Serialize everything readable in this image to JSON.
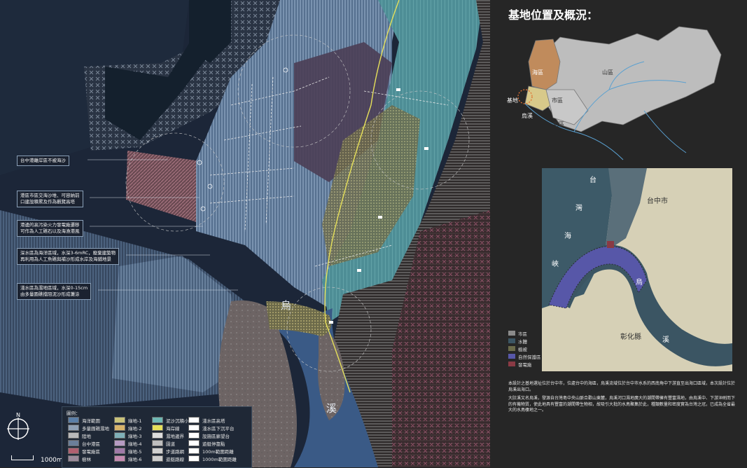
{
  "title": "基地位置及概況：",
  "callouts": [
    "台中港離岸區不被海沙",
    "港區市區交海沙堆、可容納前\n口建設積累及作為觀覽高塔",
    "港邊的高污染火力發電廠遷移\n可作為人工礁石以及海漁港風",
    "深水區為海洋區域，水深3-6mRC，廢棄建築物\n再利用為人工魚礁與補沙形成水岸及海鋪地景",
    "淺水區為濕地區域，水深0-15cm\n由多量圓礁擋阻泥沙形成灘涂"
  ],
  "map_labels": {
    "wu": "烏",
    "xi": "溪"
  },
  "scale_label": "1000m",
  "compass_label": "N",
  "legend": {
    "title": "圖例：",
    "items": [
      {
        "label": "海洋範圍",
        "color": "#5b7fa8"
      },
      {
        "label": "多量圓礁濕地",
        "color": "#8fa0b5"
      },
      {
        "label": "陸地",
        "color": "#b9b9b9"
      },
      {
        "label": "台中港區",
        "color": "#6b7f99"
      },
      {
        "label": "發電廠區",
        "color": "#b06070"
      },
      {
        "label": "樹林",
        "color": "#9a8a9a"
      },
      {
        "label": "綠地-1",
        "color": "#c9c27a"
      },
      {
        "label": "綠地-2",
        "color": "#d7b36a"
      },
      {
        "label": "綠地-3",
        "color": "#7fb0b8"
      },
      {
        "label": "綠地-4",
        "color": "#b59bc2"
      },
      {
        "label": "綠地-5",
        "color": "#a07aa8"
      },
      {
        "label": "綠地-6",
        "color": "#c38ab0"
      },
      {
        "label": "泥沙沉積小島",
        "color": "#6fb8b4"
      },
      {
        "label": "海岸線",
        "color": "#e6e05a"
      },
      {
        "label": "濕地邊界",
        "color": "#dddddd"
      },
      {
        "label": "園道",
        "color": "#bfbfbf"
      },
      {
        "label": "步道路網",
        "color": "#d0d0d0"
      },
      {
        "label": "遊艇路線",
        "color": "#cccccc"
      },
      {
        "label": "淺水區高塔",
        "color": "#ffffff"
      },
      {
        "label": "淺水區下沉平台",
        "color": "#ffffff"
      },
      {
        "label": "設施區廊望台",
        "color": "#ffffff"
      },
      {
        "label": "遊艇停靠點",
        "color": "#ffffff"
      },
      {
        "label": "100m範圍距離",
        "color": "#ffffff"
      },
      {
        "label": "1000m範圍距離",
        "color": "#ffffff"
      }
    ]
  },
  "inset_top": {
    "labels": {
      "hai": "海區",
      "shan": "山區",
      "shi": "市區",
      "tun": "屯區",
      "jidi": "基地",
      "wuxi": "烏溪"
    }
  },
  "inset_bottom": {
    "labels": {
      "tai": "台",
      "wan": "灣",
      "hai": "海",
      "xia": "峽",
      "taizhong": "台中市",
      "wu": "烏",
      "xi": "溪",
      "changhua": "彰化縣"
    },
    "legend": [
      {
        "label": "市區",
        "color": "#8a8a8a"
      },
      {
        "label": "水體",
        "color": "#3b5563"
      },
      {
        "label": "植被",
        "color": "#6b6b4a"
      },
      {
        "label": "自然保護區",
        "color": "#5757a8"
      },
      {
        "label": "發電廠",
        "color": "#8a3a44"
      }
    ]
  },
  "description": [
    "本設計之基地選址位於台中市，位處台中的海區，烏溪流域位於台中市水系的西南角中下游直至出海口區域，本次設計位於烏溪出海口。",
    "大肚溪又名烏溪，發源自台灣島中央山脈合歡山東麓，烏溪河口濕地廣大的潮間帶擁有豐富濕地，由烏溪中、下游沖刷而下的有機物質，使此地具有豐富的潮間帶生物相，故吸引大批的水鳥聚集於此，種類數量和密度實為台灣之冠，已成為全省最大的水鳥棲地之一。"
  ]
}
